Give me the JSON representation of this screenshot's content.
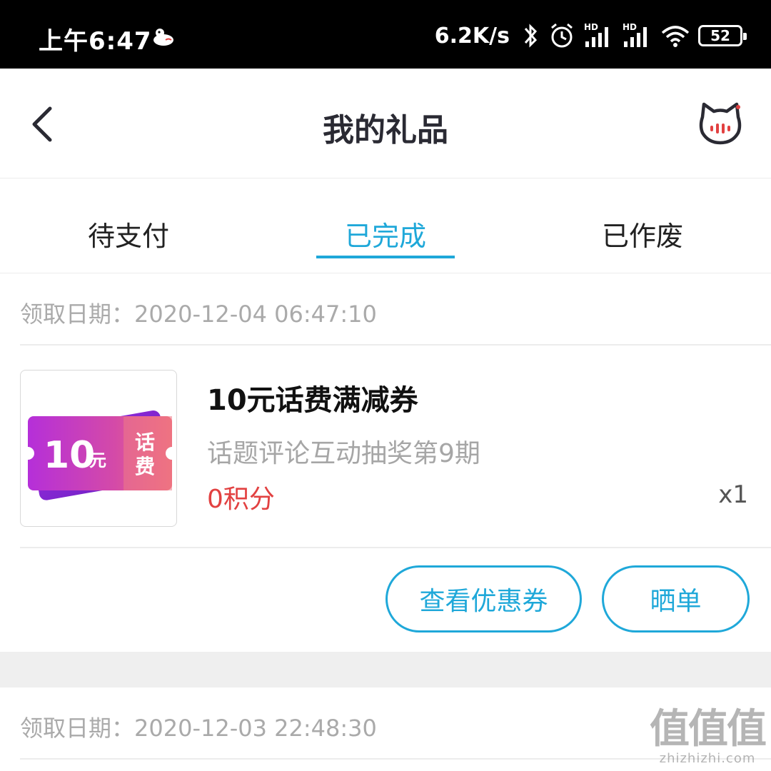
{
  "status_bar": {
    "time": "上午6:47",
    "net_speed": "6.2K/s",
    "battery": "52",
    "icons": [
      "app-notification-icon",
      "bluetooth-icon",
      "alarm-icon",
      "signal-hd-icon",
      "signal-hd-icon",
      "wifi-icon",
      "battery-icon"
    ]
  },
  "header": {
    "title": "我的礼品",
    "back_icon": "chevron-left-icon",
    "service_icon": "cat-service-icon"
  },
  "tabs": [
    {
      "label": "待支付",
      "active": false
    },
    {
      "label": "已完成",
      "active": true
    },
    {
      "label": "已作废",
      "active": false
    }
  ],
  "orders": [
    {
      "date": "领取日期：2020-12-04 06:47:10",
      "item": {
        "name": "10元话费满减券",
        "source": "话题评论互动抽奖第9期",
        "points": "0积分",
        "qty": "x1",
        "thumb": {
          "amount": "10",
          "unit": "元",
          "tag_line1": "话",
          "tag_line2": "费"
        }
      },
      "actions": {
        "view_coupon": "查看优惠券",
        "share": "晒单"
      }
    },
    {
      "date": "领取日期：2020-12-03 22:48:30"
    }
  ],
  "watermark": {
    "logo": "值值值",
    "url": "zhizhizhi.com"
  },
  "colors": {
    "accent": "#1fa8d9",
    "points_red": "#e24141",
    "coupon_purple": "#b52fd9",
    "coupon_pink": "#e0578f"
  }
}
